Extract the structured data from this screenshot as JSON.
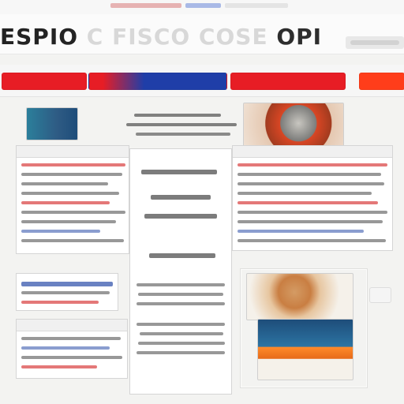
{
  "page": {
    "header": {
      "title_parts": [
        "ESPIO",
        "C",
        "FISCO",
        "COSE",
        "OPI"
      ],
      "right_hint": ""
    },
    "nav": {
      "items": [
        "",
        "",
        "",
        ""
      ],
      "accent_colors": [
        "#e71d25",
        "#1f3ea8",
        "#ff3d1a"
      ]
    },
    "sections": {
      "left_top": {
        "header": "",
        "lines": [
          "",
          "",
          "",
          "",
          "",
          "",
          "",
          "",
          "",
          ""
        ]
      },
      "center_top": {
        "header": "",
        "lines": [
          "",
          "",
          "",
          "",
          "",
          "",
          "",
          ""
        ]
      },
      "right_top": {
        "header": "",
        "lines": [
          "",
          "",
          "",
          "",
          "",
          "",
          "",
          "",
          "",
          ""
        ]
      },
      "left_bottom": {
        "header": "",
        "lines": [
          "",
          "",
          "",
          "",
          "",
          ""
        ]
      },
      "center_bottom": {
        "header": "",
        "lines": [
          "",
          "",
          "",
          "",
          "",
          "",
          "",
          ""
        ]
      },
      "right_bottom": {
        "header": "",
        "lines": [
          "",
          "",
          "",
          "",
          "",
          "",
          "",
          ""
        ]
      }
    },
    "icons": {
      "top_left_logo": "image-icon",
      "right_corner_badge": "info-icon"
    }
  }
}
